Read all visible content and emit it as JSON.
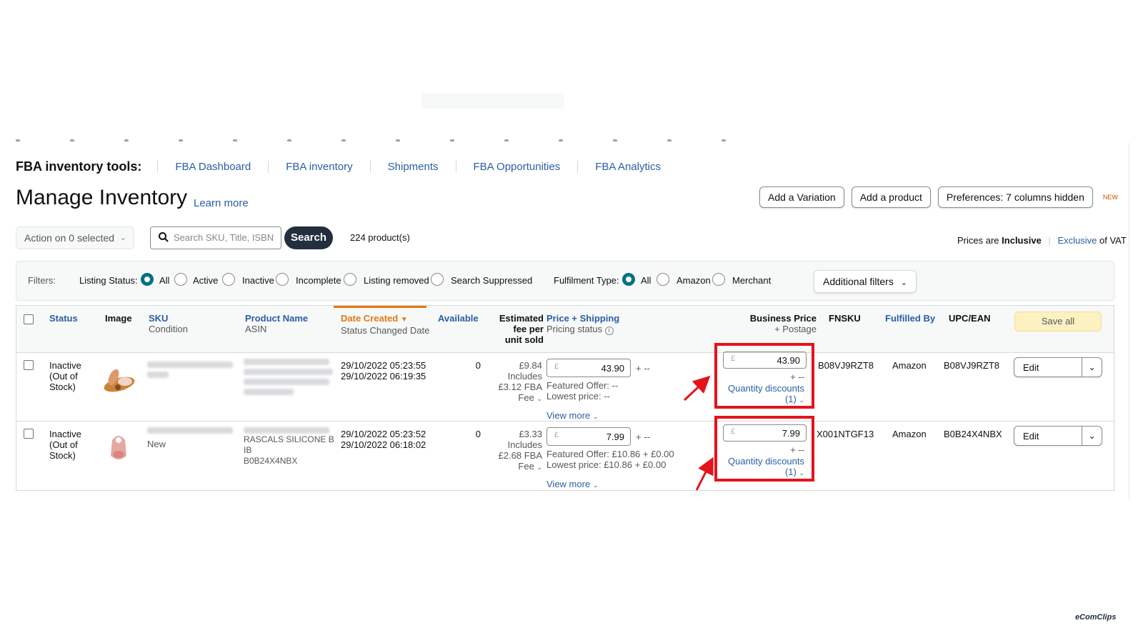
{
  "tools": {
    "title": "FBA inventory tools:",
    "links": [
      "FBA Dashboard",
      "FBA inventory",
      "Shipments",
      "FBA Opportunities",
      "FBA Analytics"
    ]
  },
  "header": {
    "title": "Manage Inventory",
    "learn_more": "Learn more",
    "buttons": [
      "Add a Variation",
      "Add a product",
      "Preferences: 7 columns hidden"
    ],
    "new_tag": "NEW"
  },
  "toolbar": {
    "action": "Action on 0 selected",
    "search_placeholder": "Search SKU, Title, ISBN",
    "search_button": "Search",
    "product_count": "224 product(s)",
    "vat_prefix": "Prices are",
    "vat_inclusive": "Inclusive",
    "vat_exclusive": "Exclusive",
    "vat_suffix": "of VAT"
  },
  "filters": {
    "label": "Filters:",
    "listing_status_label": "Listing Status:",
    "listing_status_options": [
      "All",
      "Active",
      "Inactive",
      "Incomplete",
      "Listing removed",
      "Search Suppressed"
    ],
    "listing_status_selected": "All",
    "fulfilment_label": "Fulfilment Type:",
    "fulfilment_options": [
      "All",
      "Amazon",
      "Merchant"
    ],
    "fulfilment_selected": "All",
    "additional": "Additional filters"
  },
  "table": {
    "headers": {
      "status": "Status",
      "image": "Image",
      "sku": "SKU",
      "sku_sub": "Condition",
      "product": "Product Name",
      "product_sub": "ASIN",
      "date": "Date Created",
      "date_sub": "Status Changed Date",
      "available": "Available",
      "fee_1": "Estimated",
      "fee_2": "fee per",
      "fee_3": "unit sold",
      "price": "Price + Shipping",
      "price_sub": "Pricing status",
      "business": "Business Price",
      "business_sub": "+ Postage",
      "fnsku": "FNSKU",
      "fulfilled": "Fulfilled By",
      "upc": "UPC/EAN",
      "save_all": "Save all"
    },
    "rows": [
      {
        "status_1": "Inactive",
        "status_2": "(Out of",
        "status_3": "Stock)",
        "condition": "",
        "product_line": "",
        "product_ib": "",
        "asin": "",
        "date_created": "29/10/2022 05:23:55",
        "date_changed": "29/10/2022 06:19:35",
        "available": "0",
        "fee_amount": "£9.84",
        "fee_includes": "Includes",
        "fee_fba": "£3.12 FBA",
        "fee_label": "Fee",
        "currency": "£",
        "price": "43.90",
        "shipping": "+ --",
        "featured": "Featured Offer: --",
        "lowest": "Lowest price: --",
        "view_more": "View more",
        "business_price": "43.90",
        "postage": "+ --",
        "qty_discounts": "Quantity discounts",
        "qty_count": "(1)",
        "fnsku": "B08VJ9RZT8",
        "fulfilled": "Amazon",
        "upc": "B08VJ9RZT8",
        "edit": "Edit"
      },
      {
        "status_1": "Inactive",
        "status_2": "(Out of",
        "status_3": "Stock)",
        "condition": "New",
        "product_line": "RASCALS SILICONE B",
        "product_ib": "IB",
        "asin": "B0B24X4NBX",
        "date_created": "29/10/2022 05:23:52",
        "date_changed": "29/10/2022 06:18:02",
        "available": "0",
        "fee_amount": "£3.33",
        "fee_includes": "Includes",
        "fee_fba": "£2.68 FBA",
        "fee_label": "Fee",
        "currency": "£",
        "price": "7.99",
        "shipping": "+ --",
        "featured": "Featured Offer: £10.86 + £0.00",
        "lowest": "Lowest price: £10.86 + £0.00",
        "view_more": "View more",
        "business_price": "7.99",
        "postage": "+ --",
        "qty_discounts": "Quantity discounts",
        "qty_count": "(1)",
        "fnsku": "X001NTGF13",
        "fulfilled": "Amazon",
        "upc": "B0B24X4NBX",
        "edit": "Edit"
      }
    ]
  },
  "watermark": "eComClips",
  "colors": {
    "link": "#2a5fa5",
    "accent_orange": "#e47911",
    "radio_selected": "#007185",
    "highlight_red": "#e3131c",
    "search_button": "#232f3e"
  }
}
